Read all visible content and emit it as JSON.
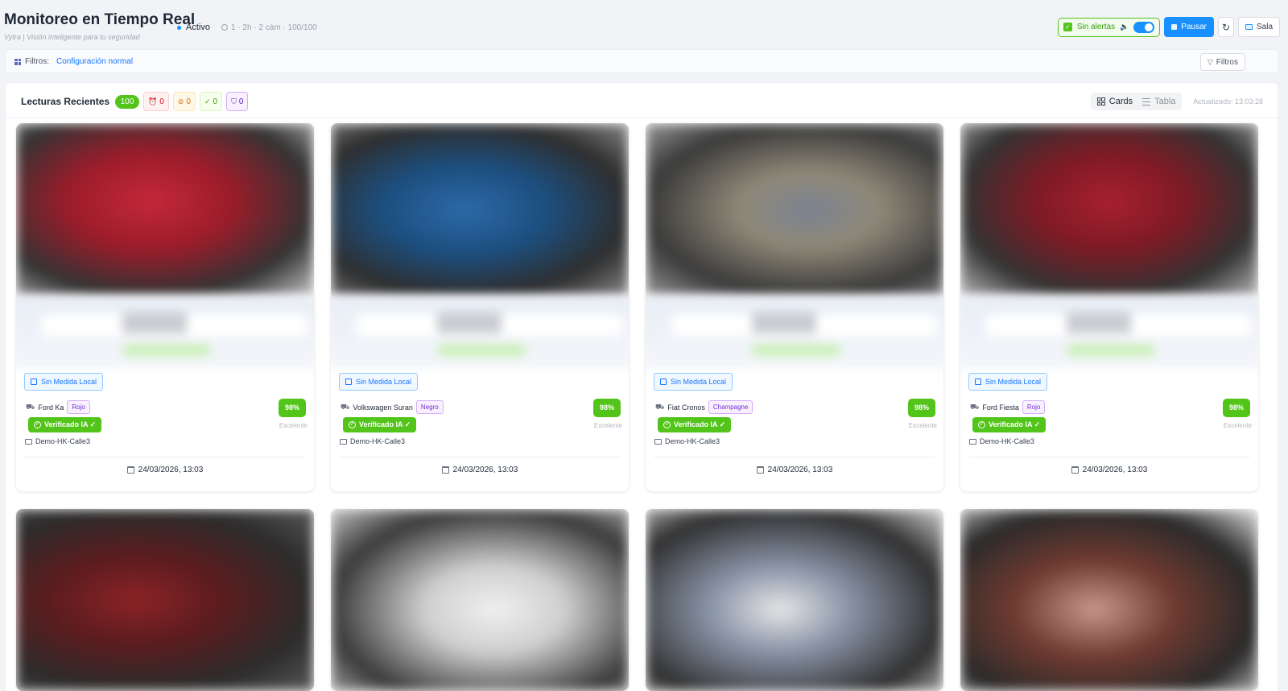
{
  "header": {
    "title": "Monitoreo en Tiempo Real",
    "subtitle": "Vytra | Visión inteligente para tu seguridad",
    "status": "Activo",
    "meta": "1 · 2h · 2 cám · 100/100",
    "alerts_label": "Sin alertas",
    "alerts_toggle_on": true,
    "pause_label": "Pausar",
    "room_label": "Sala"
  },
  "filters": {
    "label": "Filtros:",
    "value": "Configuración normal",
    "button": "Filtros"
  },
  "panel": {
    "title": "Lecturas Recientes",
    "total": "100",
    "chips": [
      "0",
      "0",
      "0",
      "0"
    ],
    "view_cards": "Cards",
    "view_table": "Tabla",
    "updated": "Actualizado: 13:03:28"
  },
  "colors": {
    "primary": "#1890ff",
    "success": "#52c41a"
  },
  "cards": [
    {
      "medida": "Sin Medida Local",
      "vehicle": "Ford Ka",
      "color": "Rojo",
      "verified": "Verificado IA ✓",
      "camera": "Demo-HK-Calle3",
      "score": "98%",
      "quality": "Excelente",
      "date": "24/03/2026, 13:03"
    },
    {
      "medida": "Sin Medida Local",
      "vehicle": "Volkswagen Suran",
      "color": "Negro",
      "verified": "Verificado IA ✓",
      "camera": "Demo-HK-Calle3",
      "score": "98%",
      "quality": "Excelente",
      "date": "24/03/2026, 13:03"
    },
    {
      "medida": "Sin Medida Local",
      "vehicle": "Fiat Cronos",
      "color": "Champagne",
      "verified": "Verificado IA ✓",
      "camera": "Demo-HK-Calle3",
      "score": "98%",
      "quality": "Excelente",
      "date": "24/03/2026, 13:03"
    },
    {
      "medida": "Sin Medida Local",
      "vehicle": "Ford Fiesta",
      "color": "Rojo",
      "verified": "Verificado IA ✓",
      "camera": "Demo-HK-Calle3",
      "score": "98%",
      "quality": "Excelente",
      "date": "24/03/2026, 13:03"
    }
  ]
}
